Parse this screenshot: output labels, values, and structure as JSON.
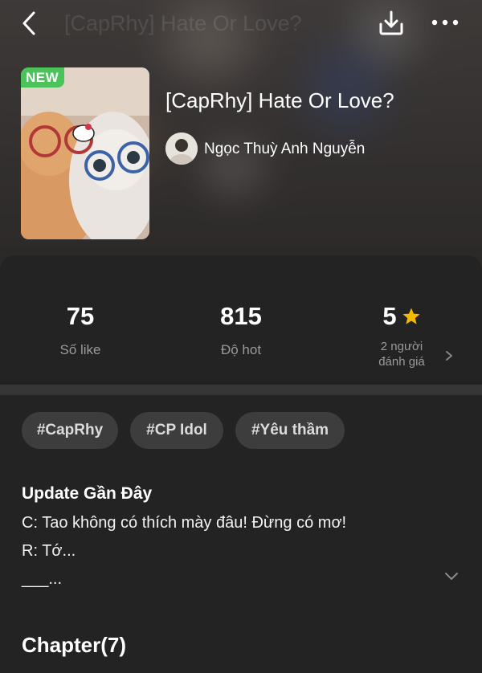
{
  "header": {
    "title_ghost": "[CapRhy] Hate Or Love?",
    "back_icon": "chevron-left-icon",
    "download_icon": "download-icon",
    "more_icon": "more-horizontal-icon"
  },
  "book": {
    "badge": "NEW",
    "title": "[CapRhy] Hate Or Love?",
    "author": "Ngọc Thuỳ Anh Nguyễn"
  },
  "stats": {
    "likes": {
      "value": "75",
      "label": "Số like"
    },
    "hot": {
      "value": "815",
      "label": "Độ hot"
    },
    "rating": {
      "value": "5",
      "label_line1": "2 người",
      "label_line2": "đánh giá"
    }
  },
  "tags": [
    "#CapRhy",
    "#CP Idol",
    "#Yêu thầm"
  ],
  "update": {
    "title": "Update Gần Đây",
    "lines": [
      "C: Tao không có thích mày đâu! Đừng có mơ!",
      "R: Tớ...",
      "___..."
    ]
  },
  "chapters": {
    "title": "Chapter(7)"
  },
  "colors": {
    "accent_star": "#f5b800",
    "badge_green": "#4cc25a",
    "background": "#232323"
  }
}
